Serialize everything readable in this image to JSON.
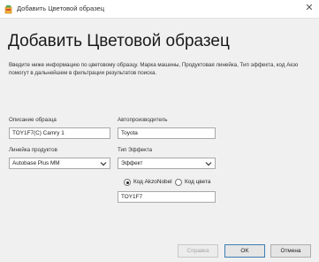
{
  "window": {
    "title": "Добавить Цветовой образец",
    "close_symbol": "✕",
    "icon": "paint-can-icon"
  },
  "heading": "Добавить Цветовой образец",
  "description": "Введите ниже информацию по цветовому образцу. Марка машины, Продуктовая линейка, Тип эффекта, код Акзо помогут в дальнейшем в фильтрации результатов поиска.",
  "fields": {
    "sample_description": {
      "label": "Описание образца",
      "value": "TOY1F7(C) Camry 1"
    },
    "manufacturer": {
      "label": "Автопроизводитель",
      "value": "Toyota"
    },
    "product_line": {
      "label": "Линейка продуктов",
      "value": "Autobase Plus MM"
    },
    "effect_type": {
      "label": "Тип Эффекта",
      "value": "Эффект"
    },
    "code_type": {
      "options": [
        "Код AkzoNobel",
        "Код цвета"
      ],
      "selected": "Код AkzoNobel"
    },
    "code_value": "TOY1F7"
  },
  "buttons": {
    "help": "Справка",
    "ok": "OK",
    "cancel": "Отмена"
  },
  "colors": {
    "accent_border": "#3c7fb1",
    "window_bg": "#f0f0f0"
  }
}
